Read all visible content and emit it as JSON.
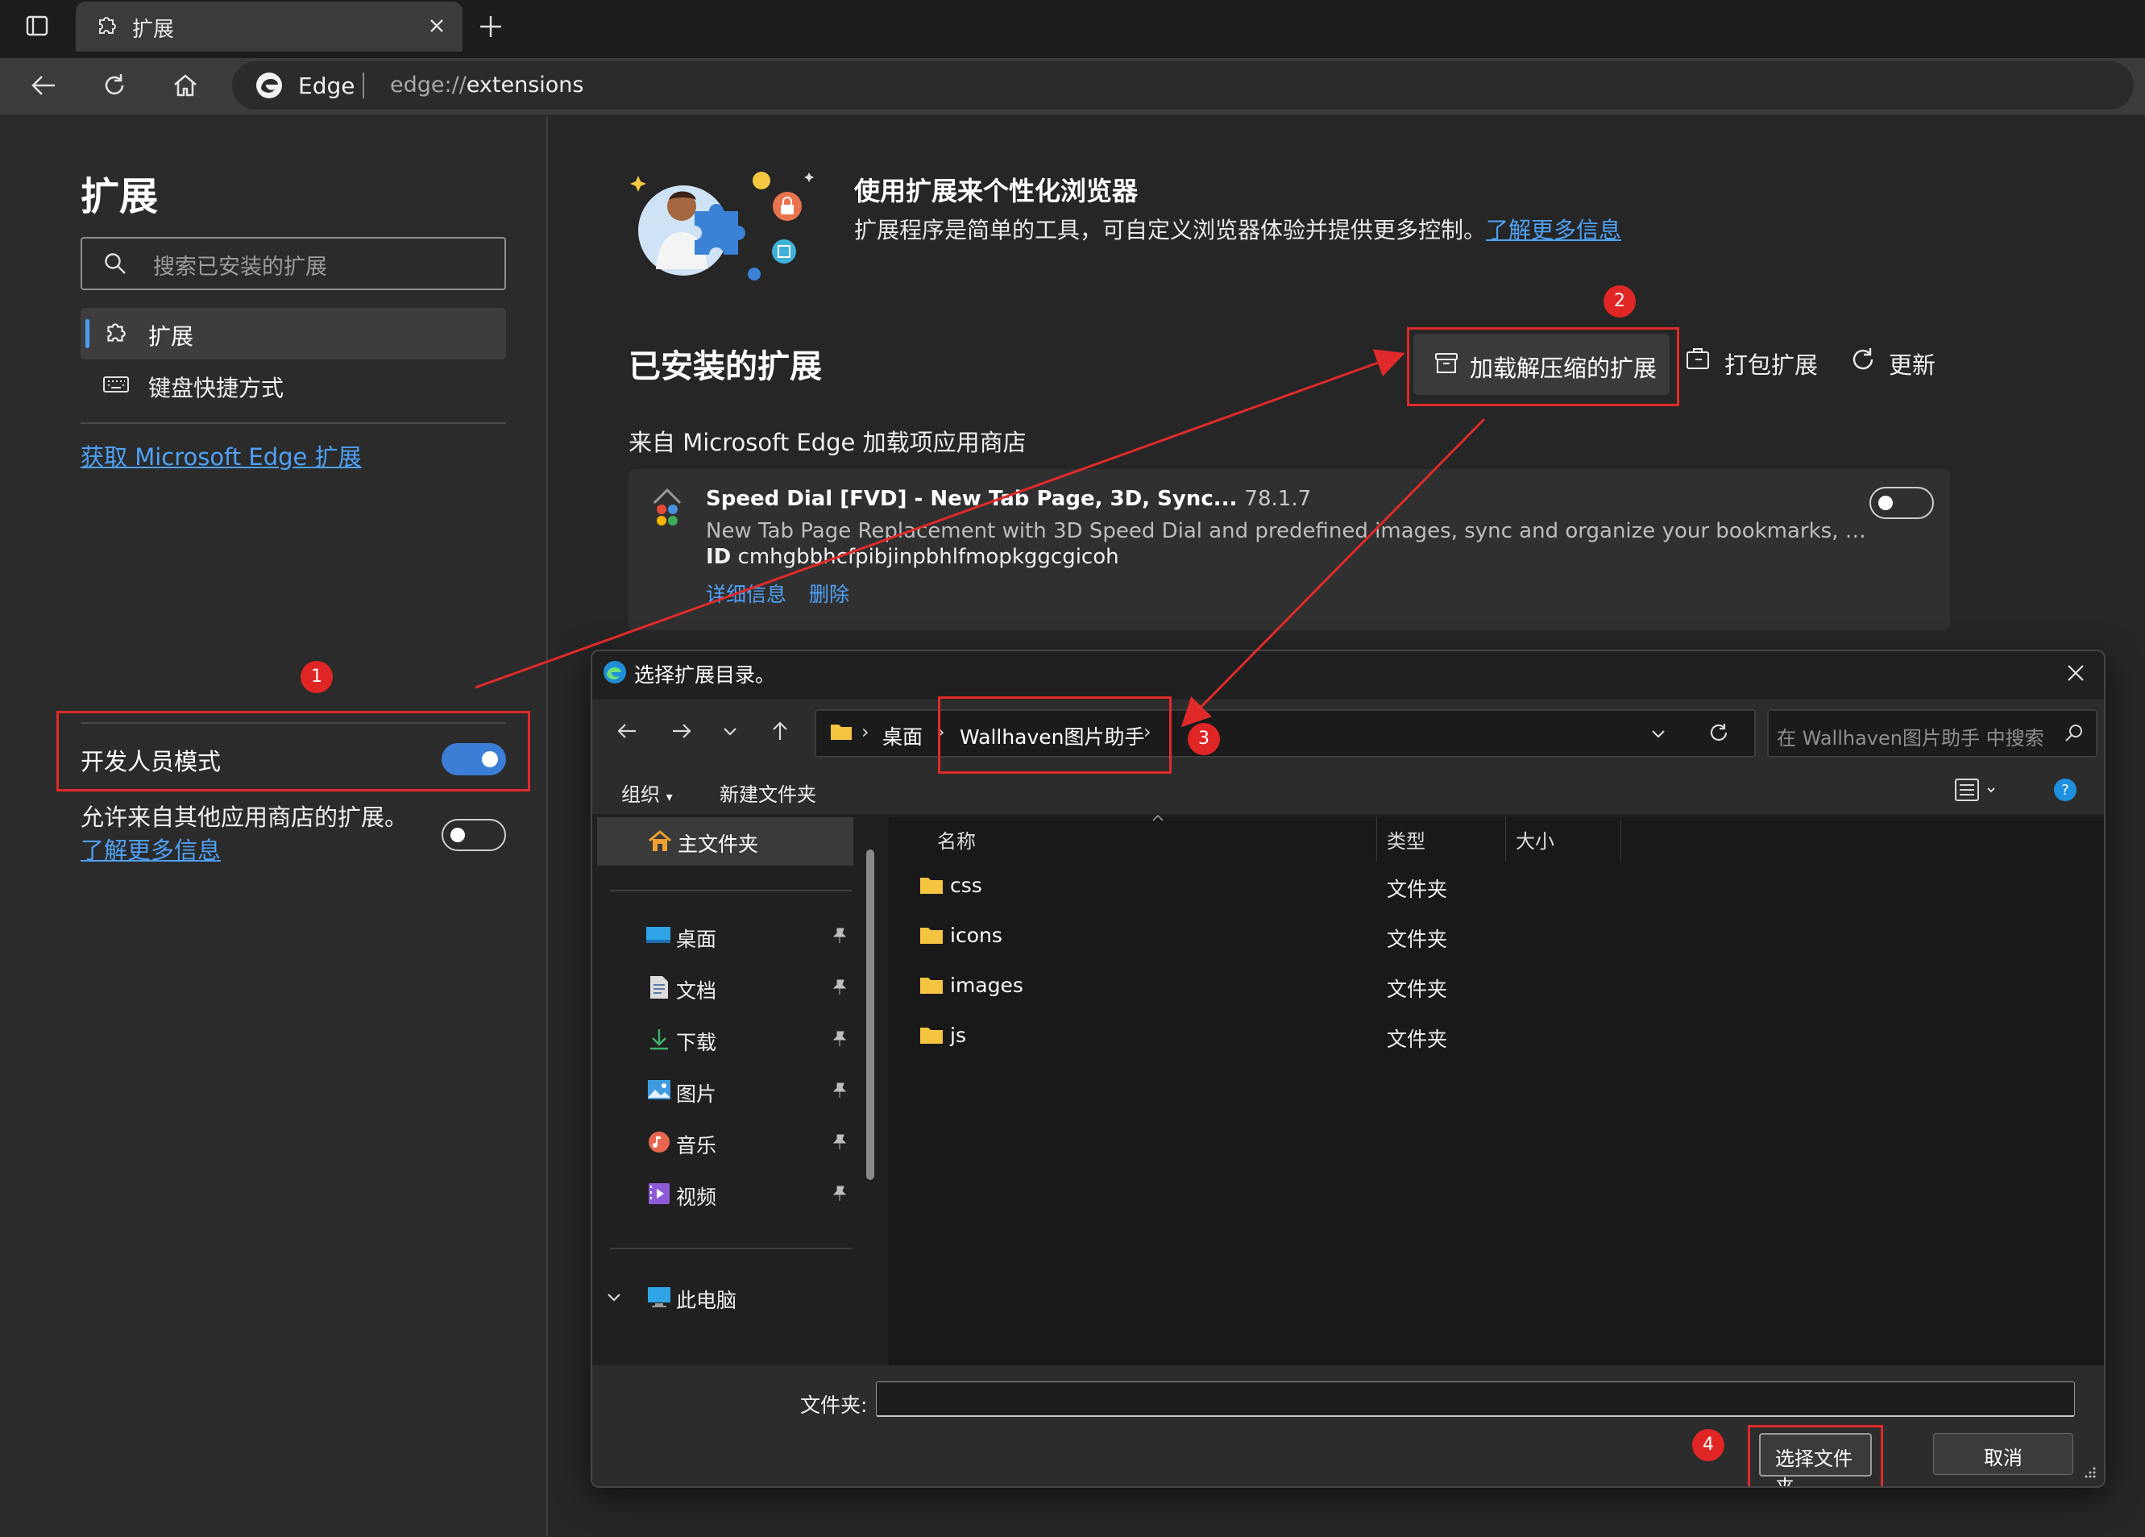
{
  "browser": {
    "tab_title": "扩展",
    "brand": "Edge",
    "url_scheme": "edge://",
    "url_path": "extensions"
  },
  "sidebar": {
    "title": "扩展",
    "search_placeholder": "搜索已安装的扩展",
    "nav": [
      {
        "label": "扩展",
        "icon": "puzzle-icon",
        "selected": true
      },
      {
        "label": "键盘快捷方式",
        "icon": "keyboard-icon",
        "selected": false
      }
    ],
    "get_extensions_link": "获取 Microsoft Edge 扩展",
    "developer_mode": {
      "label": "开发人员模式",
      "enabled": true
    },
    "other_stores": {
      "text": "允许来自其他应用商店的扩展。",
      "link": "了解更多信息",
      "enabled": false
    }
  },
  "main": {
    "hero_title": "使用扩展来个性化浏览器",
    "hero_desc": "扩展程序是简单的工具，可自定义浏览器体验并提供更多控制。",
    "hero_link": "了解更多信息",
    "installed_title": "已安装的扩展",
    "actions": {
      "load_unpacked": "加载解压缩的扩展",
      "pack": "打包扩展",
      "update": "更新"
    },
    "store_heading": "来自 Microsoft Edge 加载项应用商店",
    "extensions": [
      {
        "name": "Speed Dial [FVD] - New Tab Page, 3D, Sync...",
        "version": "78.1.7",
        "description": "New Tab Page Replacement with 3D Speed Dial and predefined images, sync and organize your bookmarks, groups, and m…",
        "id_label": "ID",
        "id": "cmhgbbhcfpibjinpbhlfmopkggcgicoh",
        "details_link": "详细信息",
        "remove_link": "删除",
        "enabled": false
      }
    ]
  },
  "dialog": {
    "title": "选择扩展目录。",
    "breadcrumb": [
      "桌面",
      "Wallhaven图片助手"
    ],
    "search_placeholder": "在 Wallhaven图片助手 中搜索",
    "commands": {
      "organize": "组织",
      "new_folder": "新建文件夹"
    },
    "nav_home": "主文件夹",
    "nav_items": [
      {
        "label": "桌面",
        "icon": "desktop-icon"
      },
      {
        "label": "文档",
        "icon": "documents-icon"
      },
      {
        "label": "下载",
        "icon": "download-icon"
      },
      {
        "label": "图片",
        "icon": "pictures-icon"
      },
      {
        "label": "音乐",
        "icon": "music-icon"
      },
      {
        "label": "视频",
        "icon": "videos-icon"
      }
    ],
    "nav_this_pc": "此电脑",
    "columns": {
      "name": "名称",
      "type": "类型",
      "size": "大小"
    },
    "files": [
      {
        "name": "css",
        "type": "文件夹"
      },
      {
        "name": "icons",
        "type": "文件夹"
      },
      {
        "name": "images",
        "type": "文件夹"
      },
      {
        "name": "js",
        "type": "文件夹"
      }
    ],
    "folder_field_label": "文件夹:",
    "folder_field_value": "",
    "select_button": "选择文件夹",
    "cancel_button": "取消"
  },
  "annotations": {
    "badges": [
      "1",
      "2",
      "3",
      "4"
    ],
    "highlight_color": "#e02a2a"
  },
  "colors": {
    "accent": "#4ea1f5",
    "toggle_on": "#3a7ed6",
    "background": "#262626"
  }
}
